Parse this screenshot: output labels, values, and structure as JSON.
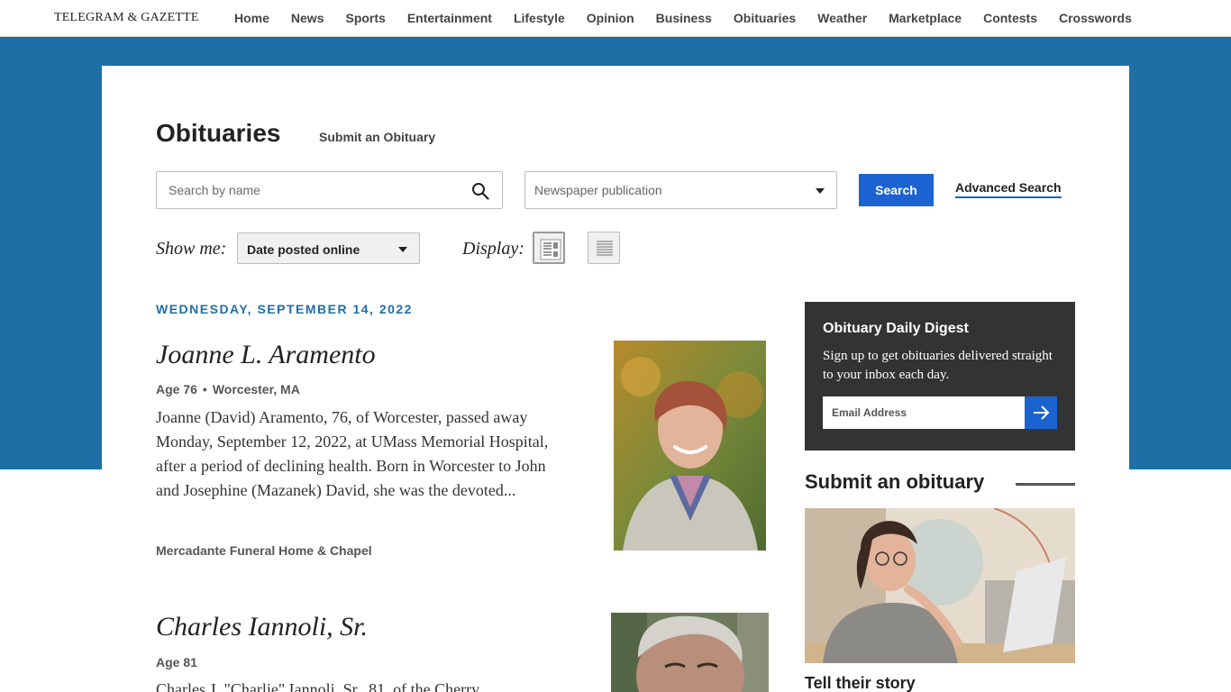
{
  "site": {
    "logo": "TELEGRAM & GAZETTE"
  },
  "nav": [
    "Home",
    "News",
    "Sports",
    "Entertainment",
    "Lifestyle",
    "Opinion",
    "Business",
    "Obituaries",
    "Weather",
    "Marketplace",
    "Contests",
    "Crosswords"
  ],
  "page": {
    "title": "Obituaries",
    "submit_link": "Submit an Obituary"
  },
  "search": {
    "name_placeholder": "Search by name",
    "publication_placeholder": "Newspaper publication",
    "button": "Search",
    "advanced": "Advanced Search"
  },
  "filters": {
    "show_me_label": "Show me:",
    "show_me_value": "Date posted online",
    "display_label": "Display:"
  },
  "date_heading": "WEDNESDAY, SEPTEMBER 14, 2022",
  "obituaries": [
    {
      "name": "Joanne L. Aramento",
      "age": "Age 76",
      "location": "Worcester, MA",
      "excerpt": "Joanne (David) Aramento, 76, of Worcester, passed away Monday, September 12, 2022, at UMass Memorial Hospital, after a period of declining health. Born in Worcester to John and Josephine (Mazanek) David, she was the devoted...",
      "funeral_home": "Mercadante Funeral Home & Chapel"
    },
    {
      "name": "Charles Iannoli, Sr.",
      "age": "Age 81",
      "location": "",
      "excerpt": "Charles J. \"Charlie\" Iannoli, Sr., 81, of the Cherry",
      "funeral_home": ""
    }
  ],
  "sidebar": {
    "digest_title": "Obituary Daily Digest",
    "digest_text": "Sign up to get obituaries delivered straight to your inbox each day.",
    "email_placeholder": "Email Address",
    "submit_heading": "Submit an obituary",
    "tell_story": "Tell their story"
  },
  "colors": {
    "brand_blue": "#1f6fa6",
    "button_blue": "#1b63d1",
    "digest_bg": "#333333"
  }
}
